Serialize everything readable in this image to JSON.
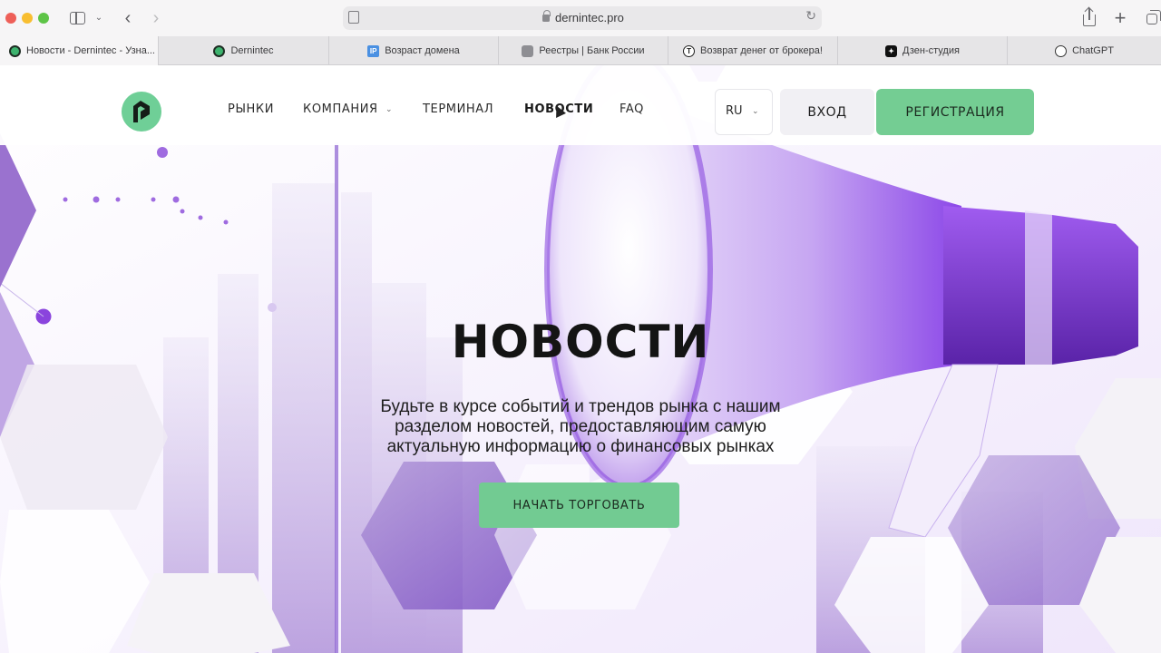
{
  "browser": {
    "url": "dernintec.pro",
    "tabs": [
      {
        "label": "Новости - Dernintec - Узна...",
        "icon": "dernintec-favicon",
        "active": true
      },
      {
        "label": "Dernintec",
        "icon": "dernintec-favicon"
      },
      {
        "label": "Возраст домена",
        "icon": "ip-favicon"
      },
      {
        "label": "Реестры | Банк России",
        "icon": "bank-russia-favicon"
      },
      {
        "label": "Возврат денег от брокера!",
        "icon": "t-favicon"
      },
      {
        "label": "Дзен-студия",
        "icon": "dzen-favicon"
      },
      {
        "label": "ChatGPT",
        "icon": "chatgpt-favicon"
      }
    ]
  },
  "header": {
    "nav": [
      {
        "label": "РЫНКИ"
      },
      {
        "label": "КОМПАНИЯ"
      },
      {
        "label": "ТЕРМИНАЛ"
      },
      {
        "label": "НОВОСТИ",
        "current": true
      },
      {
        "label": "FAQ"
      }
    ],
    "lang": "RU",
    "login_label": "ВХОД",
    "register_label": "РЕГИСТРАЦИЯ"
  },
  "hero": {
    "title": "НОВОСТИ",
    "subtitle": "Будьте в курсе событий и трендов рынка с нашим разделом новостей, предоставляющим самую актуальную информацию о финансовых рынках",
    "cta_label": "НАЧАТЬ ТОРГОВАТЬ"
  },
  "colors": {
    "accent_green": "#74cd93",
    "accent_purple": "#8b45e6"
  }
}
